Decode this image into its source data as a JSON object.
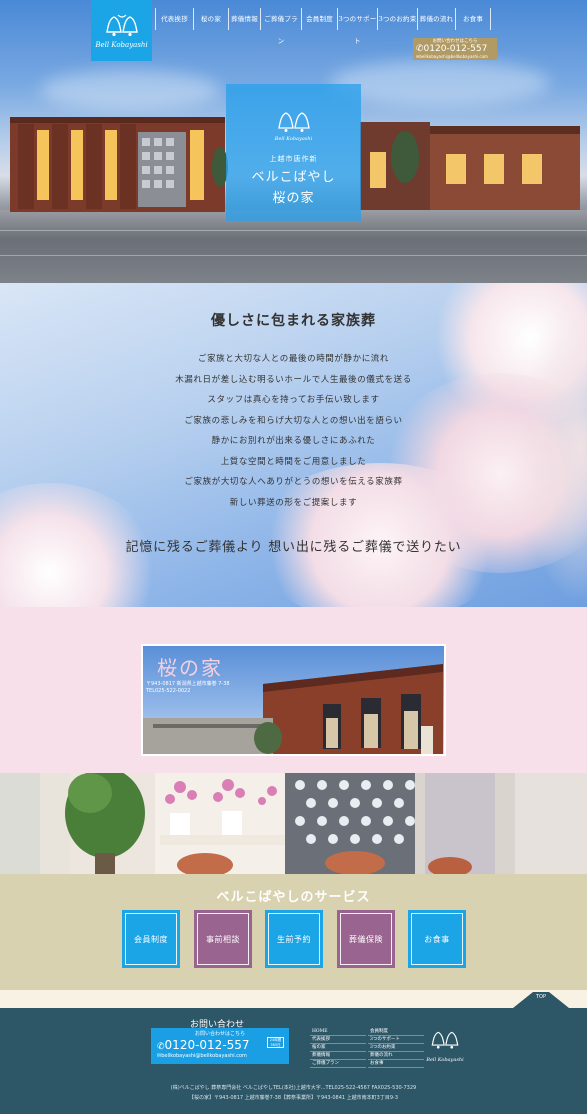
{
  "header": {
    "logo_text": "Bell Kobayashi",
    "nav": [
      "代表挨拶",
      "桜の家",
      "葬儀情報",
      "ご葬儀プラン",
      "会員制度",
      "3つのサポート",
      "3つのお約束",
      "葬儀の流れ",
      "お食事"
    ],
    "tel": {
      "caption": "お問い合わせはこちら",
      "number": "0120-012-557",
      "email": "bellkobayashi@bellkobayashi.com"
    }
  },
  "hero": {
    "logo_text": "Bell Kobayashi",
    "subtitle": "上越市唐作新",
    "title_line1": "ベルこばやし",
    "title_line2": "桜の家"
  },
  "intro": {
    "title": "優しさに包まれる家族葬",
    "lines": [
      "ご家族と大切な人との最後の時間が静かに流れ",
      "木漏れ日が差し込む明るいホールで人生最後の儀式を送る",
      "スタッフは真心を持ってお手伝い致します",
      "ご家族の悲しみを和らげ大切な人との想い出を語らい",
      "静かにお別れが出来る優しさにあふれた",
      "上質な空間と時間をご用意しました",
      "ご家族が大切な人へありがとうの想いを伝える家族葬",
      "新しい葬送の形をご提案します"
    ],
    "catch": "記憶に残るご葬儀より 想い出に残るご葬儀で送りたい"
  },
  "banner": {
    "title": "桜の家",
    "address": "〒943-0817 新潟県上越市藤巻 7-38",
    "tel": "TEL025-522-0022"
  },
  "services": {
    "title": "ベルこばやしのサービス",
    "items": [
      {
        "label": "会員制度",
        "color": "#1ba4e6"
      },
      {
        "label": "事前相談",
        "color": "#9a6491"
      },
      {
        "label": "生前予約",
        "color": "#1ba4e6"
      },
      {
        "label": "葬儀保険",
        "color": "#9a6491"
      },
      {
        "label": "お食事",
        "color": "#1ba4e6"
      }
    ]
  },
  "top_label": "TOP",
  "footer": {
    "contact_title": "お問い合わせ",
    "contact_caption": "お問い合わせはこちら",
    "tel": "0120-012-557",
    "badge": "24時間 365日",
    "email": "bellkobayashi@bellkobayashi.com",
    "nav_left": [
      "HOME",
      "代表挨拶",
      "桜の家",
      "葬儀情報",
      "ご葬儀プラン"
    ],
    "nav_right": [
      "会員制度",
      "3つのサポート",
      "3つのお約束",
      "葬儀の流れ",
      "お食事"
    ],
    "logo_text": "Bell Kobayashi",
    "address_line1": "(株)ベルこばやし 葬祭専門会社 ベルこばやしTEL(本社)上越市大字...TEL025-522-4567 FAX025-530-7329",
    "address_line2": "【桜の家】〒943-0817 上越市藤巻7-38【葬祭事業所】〒943-0841 上越市南本町3丁目9-3"
  },
  "colors": {
    "accent_blue": "#1ba4e6",
    "accent_purple": "#9a6491",
    "footer_bg": "#2d5667",
    "services_bg": "#d9d2b0",
    "pink_bg": "#f7e0ea",
    "tel_gold": "#b19a63"
  }
}
